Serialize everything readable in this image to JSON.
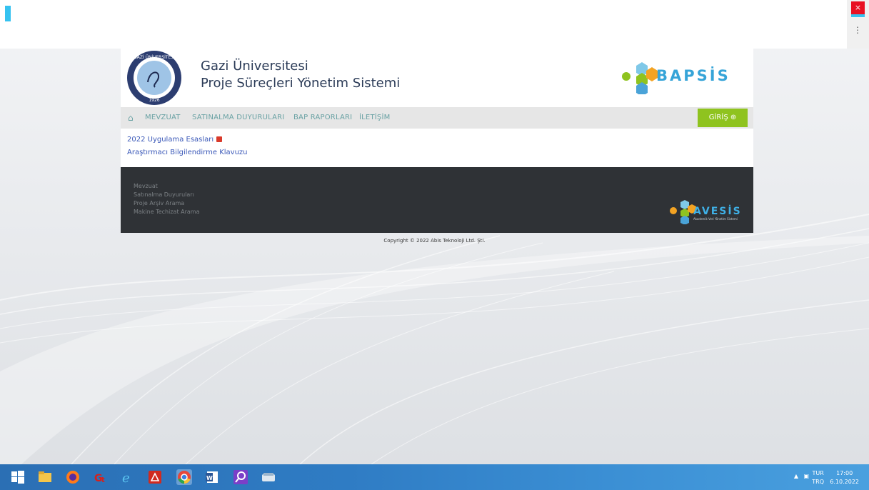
{
  "header": {
    "university": "Gazi Üniversitesi",
    "system": "Proje Süreçleri Yönetim Sistemi",
    "seal_text": "GAZİ ÜNİVERSİTESİ",
    "seal_year": "1926",
    "brand": "BAPSİS"
  },
  "nav": {
    "items": [
      "MEVZUAT",
      "SATINALMA DUYURULARI",
      "BAP RAPORLARI",
      "İLETİŞİM"
    ],
    "login_label": "GİRİŞ ⊕"
  },
  "content": {
    "links": [
      "2022 Uygulama Esasları",
      "Araştırmacı Bilgilendirme Klavuzu"
    ]
  },
  "footer": {
    "links": [
      "Mevzuat",
      "Satınalma Duyuruları",
      "Proje Arşiv Arama",
      "Makine Techizat Arama"
    ],
    "brand": "AVESİS",
    "brand_sub": "Akademik Veri Yönetim Sistemi"
  },
  "copyright": "Copyright © 2022 Abis Teknoloji Ltd. Şti.",
  "window": {
    "close_label": "×",
    "menu_label": "⋮"
  },
  "taskbar": {
    "apps": [
      "start-icon",
      "file-explorer-icon",
      "firefox-icon",
      "app-icon",
      "internet-explorer-icon",
      "acrobat-icon",
      "chrome-icon",
      "word-icon",
      "search-app-icon",
      "scanner-icon"
    ],
    "lang_top": "TUR",
    "lang_bottom": "TRQ",
    "time": "17:00",
    "date": "6.10.2022"
  },
  "colors": {
    "accent_green": "#8fc31f",
    "nav_text": "#6aa2a4",
    "link_blue": "#3a58b8",
    "footer_bg": "#2f3236"
  }
}
